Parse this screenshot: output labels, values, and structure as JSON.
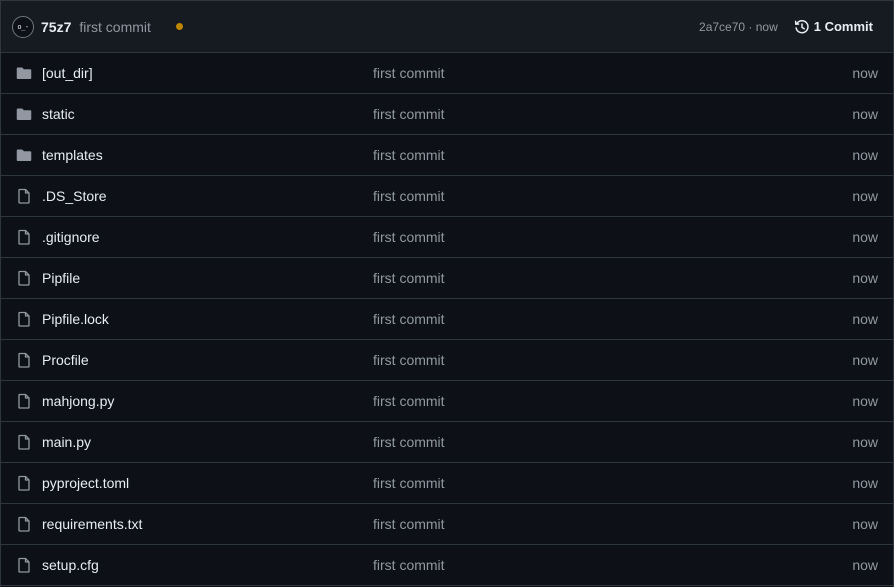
{
  "header": {
    "avatar_text": "o_-",
    "author": "75z7",
    "commit_message": "first commit",
    "status_color": "#bf8700",
    "sha": "2a7ce70",
    "separator": "·",
    "time": "now",
    "history_icon": "history-icon",
    "commits_label": "1 Commit"
  },
  "files": [
    {
      "name": "[out_dir]",
      "type": "folder",
      "message": "first commit",
      "time": "now"
    },
    {
      "name": "static",
      "type": "folder",
      "message": "first commit",
      "time": "now"
    },
    {
      "name": "templates",
      "type": "folder",
      "message": "first commit",
      "time": "now"
    },
    {
      "name": ".DS_Store",
      "type": "file",
      "message": "first commit",
      "time": "now"
    },
    {
      "name": ".gitignore",
      "type": "file",
      "message": "first commit",
      "time": "now"
    },
    {
      "name": "Pipfile",
      "type": "file",
      "message": "first commit",
      "time": "now"
    },
    {
      "name": "Pipfile.lock",
      "type": "file",
      "message": "first commit",
      "time": "now"
    },
    {
      "name": "Procfile",
      "type": "file",
      "message": "first commit",
      "time": "now"
    },
    {
      "name": "mahjong.py",
      "type": "file",
      "message": "first commit",
      "time": "now"
    },
    {
      "name": "main.py",
      "type": "file",
      "message": "first commit",
      "time": "now"
    },
    {
      "name": "pyproject.toml",
      "type": "file",
      "message": "first commit",
      "time": "now"
    },
    {
      "name": "requirements.txt",
      "type": "file",
      "message": "first commit",
      "time": "now"
    },
    {
      "name": "setup.cfg",
      "type": "file",
      "message": "first commit",
      "time": "now"
    }
  ]
}
